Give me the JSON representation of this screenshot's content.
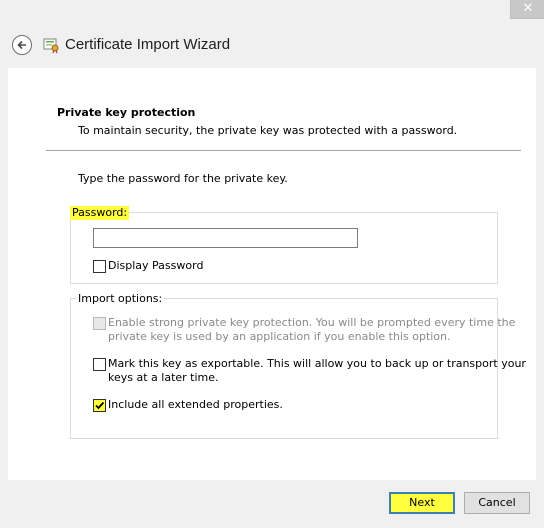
{
  "window": {
    "title": "Certificate Import Wizard",
    "close_glyph": "✕"
  },
  "section": {
    "title": "Private key protection",
    "description": "To maintain security, the private key was protected with a password."
  },
  "instruction": "Type the password for the private key.",
  "password_group": {
    "label": "Password:",
    "value": "",
    "display_password_label": "Display Password",
    "display_password_checked": false
  },
  "import_options": {
    "label": "Import options:",
    "options": [
      {
        "line1": "Enable strong private key protection. You will be prompted every time the",
        "line2": "private key is used by an application if you enable this option.",
        "checked": false,
        "enabled": false
      },
      {
        "line1": "Mark this key as exportable. This will allow you to back up or transport your",
        "line2": "keys at a later time.",
        "checked": false,
        "enabled": true
      },
      {
        "line1": "Include all extended properties.",
        "checked": true,
        "enabled": true
      }
    ]
  },
  "buttons": {
    "next": "Next",
    "cancel": "Cancel"
  },
  "colors": {
    "highlight": "#ffff40",
    "primary_border": "#3c7fb1"
  }
}
